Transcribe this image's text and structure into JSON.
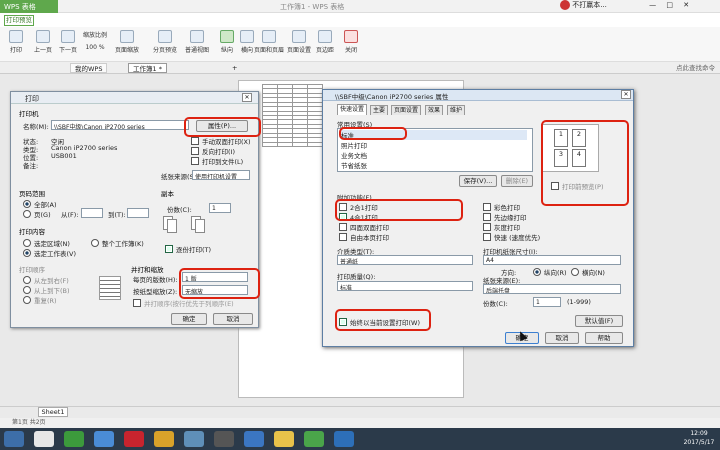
{
  "app": {
    "name": "WPS 表格",
    "window_title": "工作簿1 - WPS 表格",
    "user": "不打赢本...",
    "ribbon_tab": "打印预览"
  },
  "toolbar": {
    "items": [
      {
        "name": "print-button",
        "label": "打印"
      },
      {
        "name": "prev-page-button",
        "label": "上一页"
      },
      {
        "name": "next-page-button",
        "label": "下一页"
      },
      {
        "name": "zoom-button",
        "label": "100 %"
      },
      {
        "name": "page-zoom-button",
        "label": "页面缩放"
      },
      {
        "name": "page-layout-button",
        "label": "分页预览"
      },
      {
        "name": "normal-view-button",
        "label": "普通视图"
      },
      {
        "name": "landscape-button",
        "label": "纵向"
      },
      {
        "name": "portrait-button",
        "label": "横向"
      },
      {
        "name": "page-margin-button",
        "label": "页面和页眉"
      },
      {
        "name": "page-setup-button",
        "label": "页面设置"
      },
      {
        "name": "page-break-button",
        "label": "页边距"
      },
      {
        "name": "close-button",
        "label": "关闭"
      }
    ],
    "zoom_label": "缩放比例"
  },
  "tabs": {
    "home": "我的WPS",
    "doc": "工作簿1 *",
    "add": "+"
  },
  "search": {
    "placeholder": "点此查找命令"
  },
  "sheet": {
    "tab": "Sheet1"
  },
  "status": {
    "page": "第1页 共2页"
  },
  "clock": {
    "time": "12:09",
    "date": "2017/5/17"
  },
  "print": {
    "title": "打印",
    "printer_group": "打印机",
    "name_label": "名称(M):",
    "printer_name": "\\\\SBF中级\\Canon iP2700 series",
    "properties_btn": "属性(P)...",
    "status_label": "状态:",
    "status_value": "空闲",
    "type_label": "类型:",
    "type_value": "Canon iP2700 series",
    "where_label": "位置:",
    "where_value": "USB001",
    "comment_label": "备注:",
    "reverse": "反向打印(I)",
    "to_file": "打印到文件(L)",
    "manual_duplex": "手动双面打印(X)",
    "paper_source_label": "纸张来源(S):",
    "paper_source": "使用打印机设置",
    "range_group": "页码范围",
    "all": "全部(A)",
    "pages": "页(G)",
    "from": "从(F):",
    "to": "到(T):",
    "content_group": "打印内容",
    "sel": "选定区域(N)",
    "whole": "整个工作簿(K)",
    "sheet_sel": "选定工作表(V)",
    "copies_group": "副本",
    "copies_label": "份数(C):",
    "copies": "1",
    "collate": "逐份打印(T)",
    "order_group": "打印顺序",
    "order1": "从左到右(F)",
    "order2": "从上到下(B)",
    "order3": "重复(R)",
    "scale_group": "并打和缩放",
    "per_sheet_label": "每页的版数(H):",
    "per_sheet": "1 版",
    "scale_label": "按纸型缩放(Z):",
    "scale": "无缩放",
    "scale_note": "并打顺序(按行优先于列顺序(E)",
    "ok": "确定",
    "cancel": "取消"
  },
  "props": {
    "title": "\\\\SBF中级\\Canon iP2700 series 属性",
    "tabs": [
      "快速设置",
      "主要",
      "页面设置",
      "效果",
      "维护"
    ],
    "common_label": "常用设置(S)",
    "common_items": [
      "标准",
      "照片打印",
      "业务文档",
      "节省纸张"
    ],
    "save_btn": "保存(V)...",
    "delete_btn": "删除(E)",
    "preview_checkbox": "打印前预览(P)",
    "additional_label": "附加功能(F)",
    "left_features": [
      "2合1打印",
      "4合1打印",
      "四面双面打印",
      "自由本页打印"
    ],
    "right_features": [
      "彩色打印",
      "先边缘打印",
      "灰度打印",
      "快速 (速度优先)"
    ],
    "media_label": "介质类型(T):",
    "media": "普通纸",
    "paper_size_label": "打印机纸张尺寸(I):",
    "paper_size": "A4",
    "orientation_label": "方向:",
    "portrait": "纵向(R)",
    "landscape": "横向(N)",
    "quality_label": "打印质量(Q):",
    "quality": "标准",
    "source_label": "纸张来源(E):",
    "source": "后端托盘",
    "copies_label": "份数(C):",
    "copies": "1",
    "copies_range": "(1-999)",
    "always_print": "始终以当前设置打印(W)",
    "defaults_btn": "默认值(F)",
    "ok": "确定",
    "cancel": "取消",
    "help": "帮助"
  },
  "preview_pages": [
    "1",
    "2",
    "3",
    "4"
  ]
}
